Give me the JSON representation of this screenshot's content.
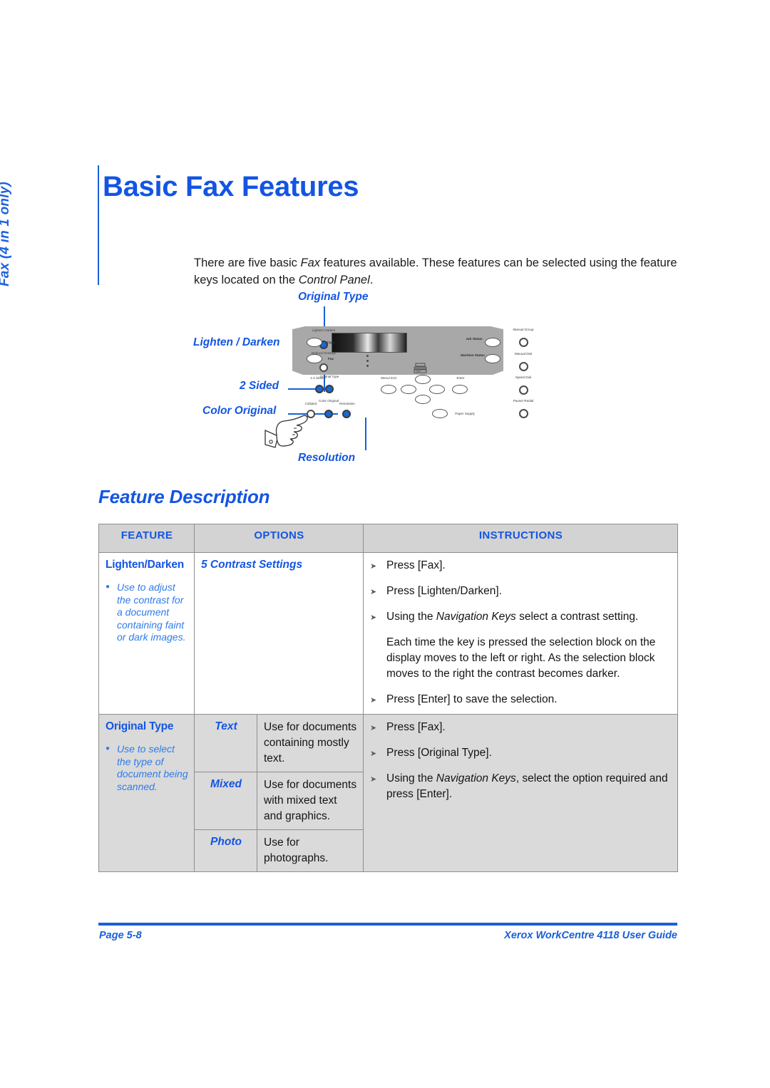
{
  "tab": {
    "label": "Fax (4 in 1 only)"
  },
  "heading": {
    "title": "Basic Fax Features",
    "section": "Feature Description"
  },
  "intro": {
    "part1": "There are five basic ",
    "em1": "Fax",
    "part2": " features available. These features can be selected using the feature keys located on the ",
    "em2": "Control Panel",
    "part3": "."
  },
  "figure": {
    "callouts": {
      "original_type": "Original Type",
      "lighten_darken": "Lighten / Darken",
      "two_sided": "2 Sided",
      "color_original": "Color Original",
      "resolution": "Resolution"
    },
    "panel_labels": {
      "lighten_darken": "Lighten/ Darken",
      "reduce_enlarge": "Reduce/ Enlarge",
      "two_sided": "1-2 Sided",
      "original_type": "Original Type",
      "collated": "Collated",
      "color_original": "Color Original",
      "resolution": "Resolution",
      "copy": "Copy",
      "fax": "Fax",
      "job_status": "Job Status",
      "machine_status": "Machine Status",
      "menu_exit": "Menu/ Exit",
      "enter": "Enter",
      "paper_supply": "Paper Supply",
      "manual_group": "Manual Group",
      "manual_dial": "Manual Dial",
      "speed_dial": "Speed Dial",
      "pause_redial": "Pause/ Redial"
    }
  },
  "table": {
    "headers": {
      "feature": "FEATURE",
      "options": "OPTIONS",
      "instructions": "INSTRUCTIONS"
    },
    "rows": [
      {
        "feature_name": "Lighten/Darken",
        "feature_note": "Use to adjust the contrast for a document containing faint or dark images.",
        "option": "5 Contrast Settings",
        "steps": [
          {
            "marker": "arrow",
            "pre": "Press [Fax].",
            "em": "",
            "post": ""
          },
          {
            "marker": "arrow",
            "pre": "Press [Lighten/Darken].",
            "em": "",
            "post": ""
          },
          {
            "marker": "arrow",
            "pre": "Using the ",
            "em": "Navigation Keys",
            "post": " select a contrast setting."
          },
          {
            "marker": "plain",
            "pre": "Each time the key is pressed the selection block on the display moves to the left or right. As the selection block moves to the right the contrast becomes darker.",
            "em": "",
            "post": ""
          },
          {
            "marker": "arrow",
            "pre": "Press [Enter] to save the selection.",
            "em": "",
            "post": ""
          }
        ]
      },
      {
        "feature_name": "Original Type",
        "feature_note": "Use to select the type of document being scanned.",
        "options": [
          {
            "name": "Text",
            "desc": "Use for documents containing mostly text."
          },
          {
            "name": "Mixed",
            "desc": "Use for documents with mixed text and graphics."
          },
          {
            "name": "Photo",
            "desc": "Use for photographs."
          }
        ],
        "steps": [
          {
            "marker": "arrow",
            "pre": "Press [Fax].",
            "em": "",
            "post": ""
          },
          {
            "marker": "arrow",
            "pre": "Press [Original Type].",
            "em": "",
            "post": ""
          },
          {
            "marker": "arrow",
            "pre": "Using the ",
            "em": "Navigation Keys",
            "post": ", select the option required and press [Enter]."
          }
        ]
      }
    ]
  },
  "footer": {
    "left": "Page 5-8",
    "right": "Xerox WorkCentre 4118 User Guide"
  },
  "colors": {
    "accent_blue": "#1355e3",
    "leader_blue": "#1860d8",
    "note_blue": "#2f7bea",
    "header_grey": "#d3d3d3",
    "row_grey": "#dadada"
  }
}
